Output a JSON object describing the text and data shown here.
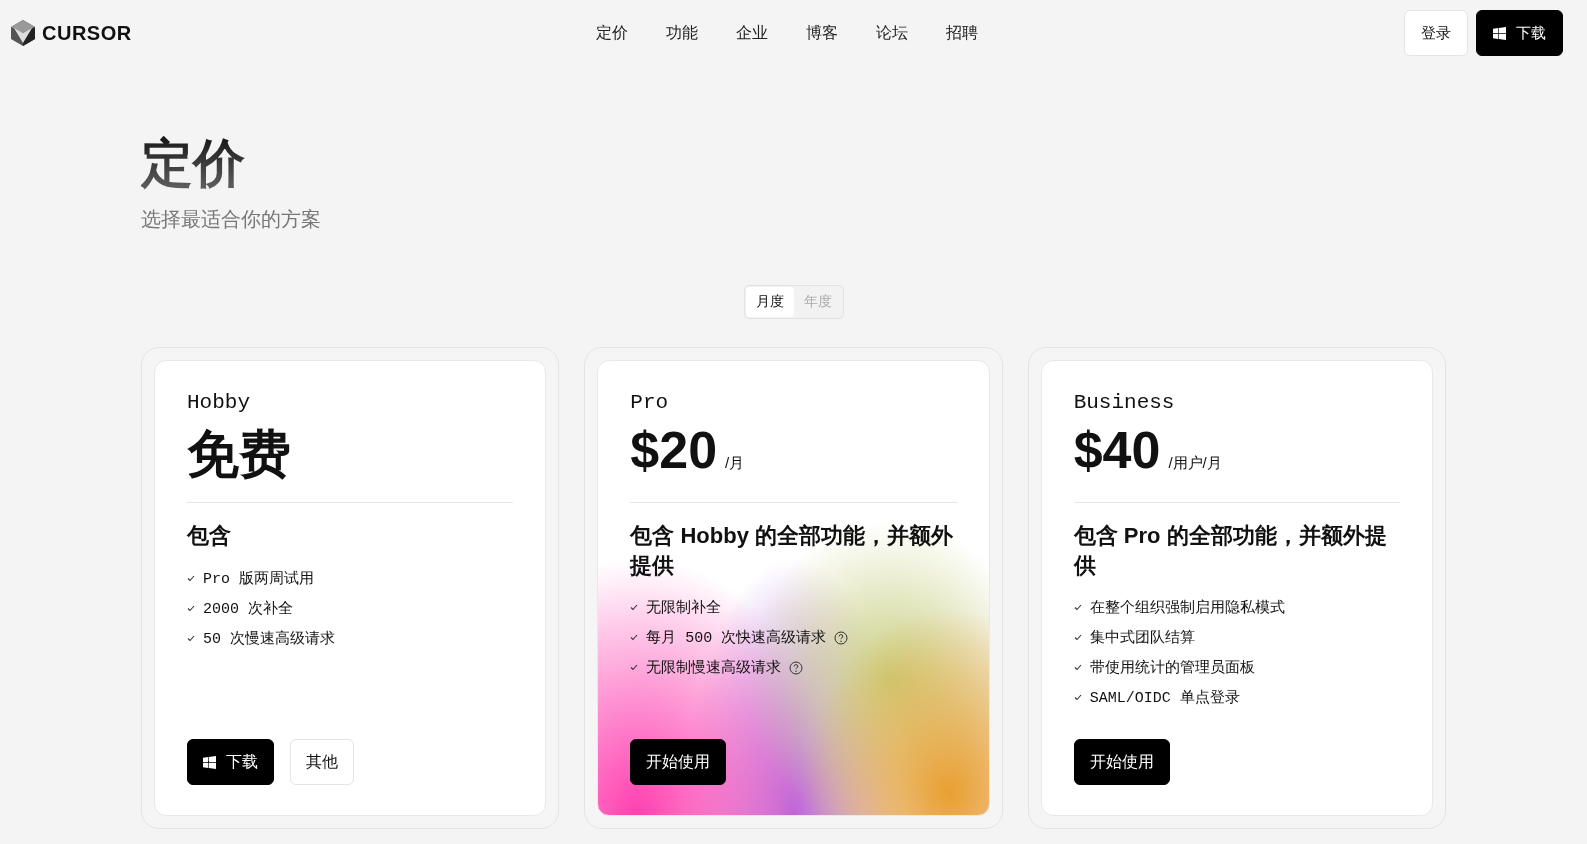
{
  "nav": {
    "brand": "CURSOR",
    "links": [
      "定价",
      "功能",
      "企业",
      "博客",
      "论坛",
      "招聘"
    ],
    "login": "登录",
    "download": "下载"
  },
  "header": {
    "title": "定价",
    "subtitle": "选择最适合你的方案"
  },
  "billing": [
    {
      "label": "月度",
      "selected": true
    },
    {
      "label": "年度",
      "selected": false
    }
  ],
  "plans": [
    {
      "name": "Hobby",
      "price": "免费",
      "highlight": false,
      "includes": "包含",
      "features": [
        {
          "text": "Pro 版两周试用",
          "help": false
        },
        {
          "text": "2000 次补全",
          "help": false
        },
        {
          "text": "50 次慢速高级请求",
          "help": false
        }
      ],
      "buttons": [
        {
          "kind": "download",
          "label": "下载"
        },
        {
          "kind": "secondary",
          "label": "其他"
        }
      ]
    },
    {
      "name": "Pro",
      "price": "$20",
      "unit": "/月",
      "highlight": true,
      "includes": "包含 Hobby 的全部功能，并额外提供",
      "features": [
        {
          "text": "无限制补全",
          "help": false
        },
        {
          "text": "每月 500 次快速高级请求",
          "help": true
        },
        {
          "text": "无限制慢速高级请求",
          "help": true
        }
      ],
      "buttons": [
        {
          "kind": "primary",
          "label": "开始使用"
        }
      ]
    },
    {
      "name": "Business",
      "price": "$40",
      "unit": "/用户/月",
      "highlight": false,
      "includes": "包含 Pro 的全部功能，并额外提供",
      "features": [
        {
          "text": "在整个组织强制启用隐私模式",
          "help": false
        },
        {
          "text": "集中式团队结算",
          "help": false
        },
        {
          "text": "带使用统计的管理员面板",
          "help": false
        },
        {
          "text": "SAML/OIDC 单点登录",
          "help": false
        }
      ],
      "buttons": [
        {
          "kind": "primary",
          "label": "开始使用"
        }
      ]
    }
  ]
}
